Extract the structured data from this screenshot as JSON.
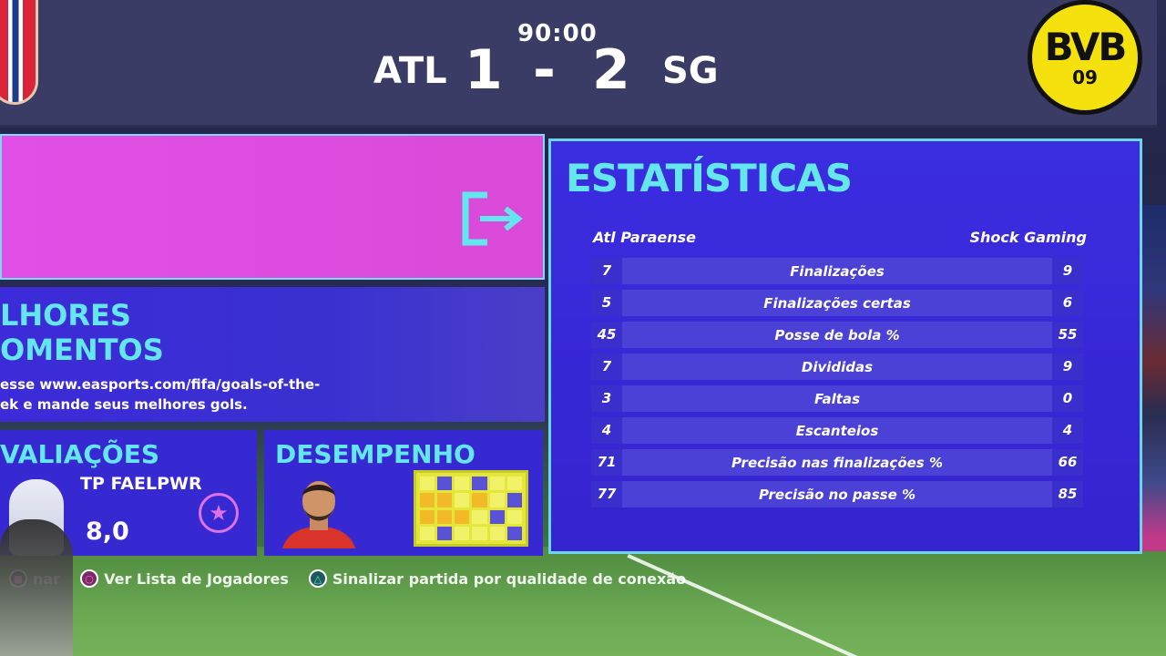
{
  "scoreboard": {
    "clock": "90:00",
    "home_team": "ATL",
    "home_score": "1",
    "separator": "-",
    "away_score": "2",
    "away_team": "SG",
    "away_badge_text": "BVB",
    "away_badge_year": "09"
  },
  "highlights": {
    "title_line1": "LHORES",
    "title_line2": "OMENTOS",
    "text_line1": "esse www.easports.com/fifa/goals-of-the-",
    "text_line2": "ek e mande seus melhores gols."
  },
  "ratings_panel": {
    "title": "VALIAÇÕES",
    "player": "TP FAELPWR",
    "rating": "8,0"
  },
  "performance_panel": {
    "title": "DESEMPENHO"
  },
  "stats": {
    "title": "ESTATÍSTICAS",
    "home_team": "Atl Paraense",
    "away_team": "Shock Gaming",
    "rows": [
      {
        "label": "Finalizações",
        "home": "7",
        "away": "9"
      },
      {
        "label": "Finalizações certas",
        "home": "5",
        "away": "6"
      },
      {
        "label": "Posse de bola %",
        "home": "45",
        "away": "55"
      },
      {
        "label": "Divididas",
        "home": "7",
        "away": "9"
      },
      {
        "label": "Faltas",
        "home": "3",
        "away": "0"
      },
      {
        "label": "Escanteios",
        "home": "4",
        "away": "4"
      },
      {
        "label": "Precisão nas finalizações %",
        "home": "71",
        "away": "66"
      },
      {
        "label": "Precisão no passe %",
        "home": "77",
        "away": "85"
      }
    ]
  },
  "hints": {
    "back": "nar",
    "player_list": "Ver Lista de Jogadores",
    "report": "Sinalizar partida por qualidade de conexão"
  },
  "colors": {
    "accent_cyan": "#64e6ef",
    "panel_blue": "#3729d2",
    "banner_pink": "#e24fe6",
    "badge_yellow": "#f5e10e"
  },
  "icons": {
    "exit": "exit-arrow-icon",
    "star": "star-icon",
    "circle_button": "circle-button-icon",
    "triangle_button": "triangle-button-icon"
  }
}
